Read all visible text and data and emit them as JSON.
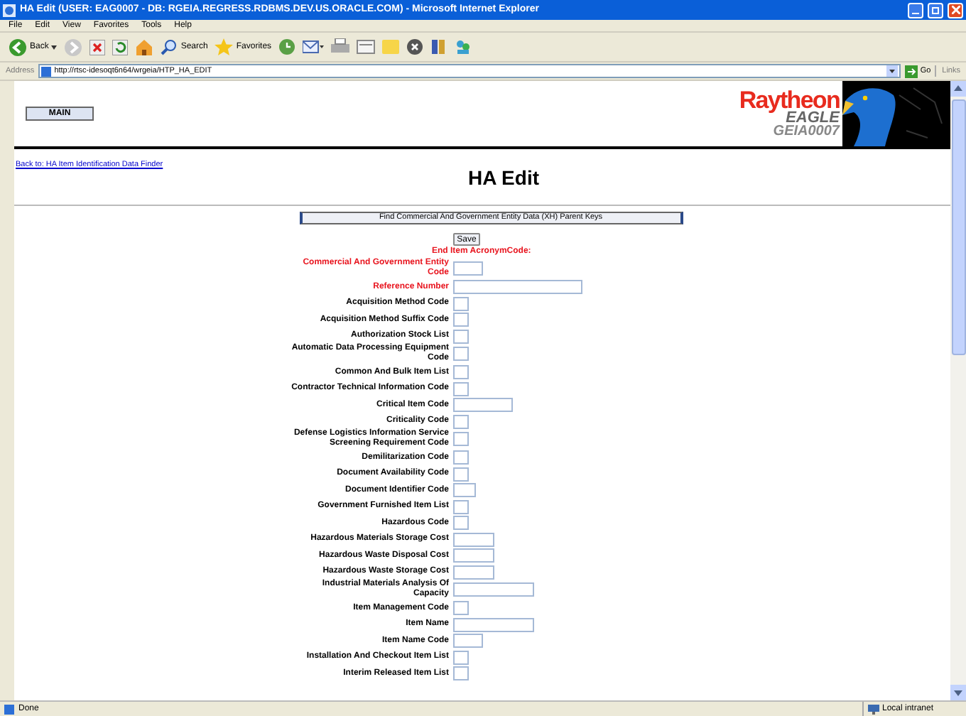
{
  "window": {
    "title": "HA Edit (USER: EAG0007 - DB: RGEIA.REGRESS.RDBMS.DEV.US.ORACLE.COM) - Microsoft Internet Explorer"
  },
  "menu": [
    "File",
    "Edit",
    "View",
    "Favorites",
    "Tools",
    "Help"
  ],
  "toolbar": {
    "back": "Back",
    "search": "Search",
    "favorites": "Favorites"
  },
  "address_bar": {
    "label": "Address",
    "url": "http://rtsc-idesoqt6n64/wrgeia/HTP_HA_EDIT",
    "go": "Go",
    "links": "Links"
  },
  "header": {
    "main_button": "MAIN",
    "logo": {
      "brand": "Raytheon",
      "product": "EAGLE",
      "code": "GEIA0007"
    }
  },
  "back_link": "Back to: HA Item Identification Data Finder",
  "page_title": "HA Edit",
  "find_button": "Find Commercial And Government Entity Data (XH) Parent Keys",
  "save_button": "Save",
  "end_item_label": "End Item AcronymCode:",
  "fields": [
    {
      "label": "Commercial And Government Entity Code",
      "required": true,
      "kind": "small"
    },
    {
      "label": "Reference Number",
      "required": true,
      "kind": "xlarge"
    },
    {
      "label": "Acquisition Method Code",
      "required": false,
      "kind": "tiny"
    },
    {
      "label": "Acquisition Method Suffix Code",
      "required": false,
      "kind": "tiny"
    },
    {
      "label": "Authorization Stock List",
      "required": false,
      "kind": "tiny"
    },
    {
      "label": "Automatic Data Processing Equipment Code",
      "required": false,
      "kind": "tiny"
    },
    {
      "label": "Common And Bulk Item List",
      "required": false,
      "kind": "tiny"
    },
    {
      "label": "Contractor Technical Information Code",
      "required": false,
      "kind": "tiny"
    },
    {
      "label": "Critical Item Code",
      "required": false,
      "kind": "large"
    },
    {
      "label": "Criticality Code",
      "required": false,
      "kind": "tiny"
    },
    {
      "label": "Defense Logistics Information Service Screening Requirement Code",
      "required": false,
      "kind": "tiny"
    },
    {
      "label": "Demilitarization Code",
      "required": false,
      "kind": "tiny"
    },
    {
      "label": "Document Availability Code",
      "required": false,
      "kind": "tiny"
    },
    {
      "label": "Document Identifier Code",
      "required": false,
      "kind": "narrow"
    },
    {
      "label": "Government Furnished Item List",
      "required": false,
      "kind": "tiny"
    },
    {
      "label": "Hazardous Code",
      "required": false,
      "kind": "tiny"
    },
    {
      "label": "Hazardous Materials Storage Cost",
      "required": false,
      "kind": "medium"
    },
    {
      "label": "Hazardous Waste Disposal Cost",
      "required": false,
      "kind": "medium"
    },
    {
      "label": "Hazardous Waste Storage Cost",
      "required": false,
      "kind": "medium"
    },
    {
      "label": "Industrial Materials Analysis Of Capacity",
      "required": false,
      "kind": "long"
    },
    {
      "label": "Item Management Code",
      "required": false,
      "kind": "tiny"
    },
    {
      "label": "Item Name",
      "required": false,
      "kind": "long"
    },
    {
      "label": "Item Name Code",
      "required": false,
      "kind": "small"
    },
    {
      "label": "Installation And Checkout Item List",
      "required": false,
      "kind": "tiny"
    },
    {
      "label": "Interim Released Item List",
      "required": false,
      "kind": "tiny"
    }
  ],
  "status_bar": {
    "text": "Done",
    "zone": "Local intranet"
  }
}
